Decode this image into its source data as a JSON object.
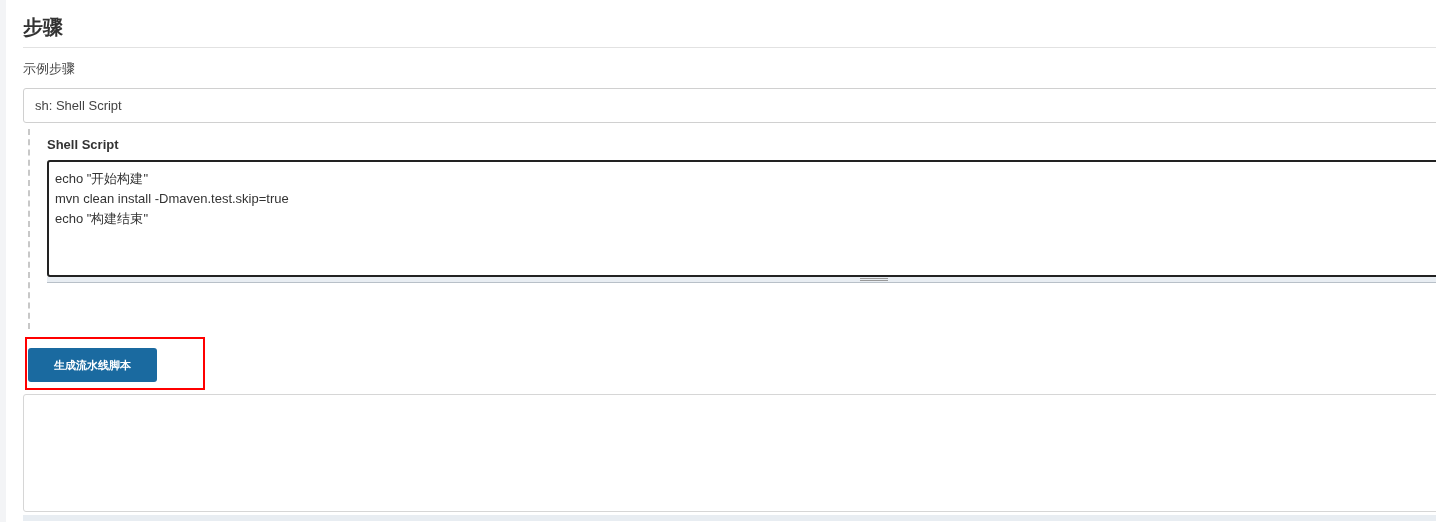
{
  "section": {
    "title": "步骤"
  },
  "sample_step": {
    "label": "示例步骤",
    "value": "sh: Shell Script"
  },
  "step_config": {
    "title": "Shell Script",
    "script": "echo \"开始构建\"\nmvn clean install -Dmaven.test.skip=true\necho \"构建结束\""
  },
  "generate_button": {
    "label": "生成流水线脚本",
    "highlighted": true
  }
}
